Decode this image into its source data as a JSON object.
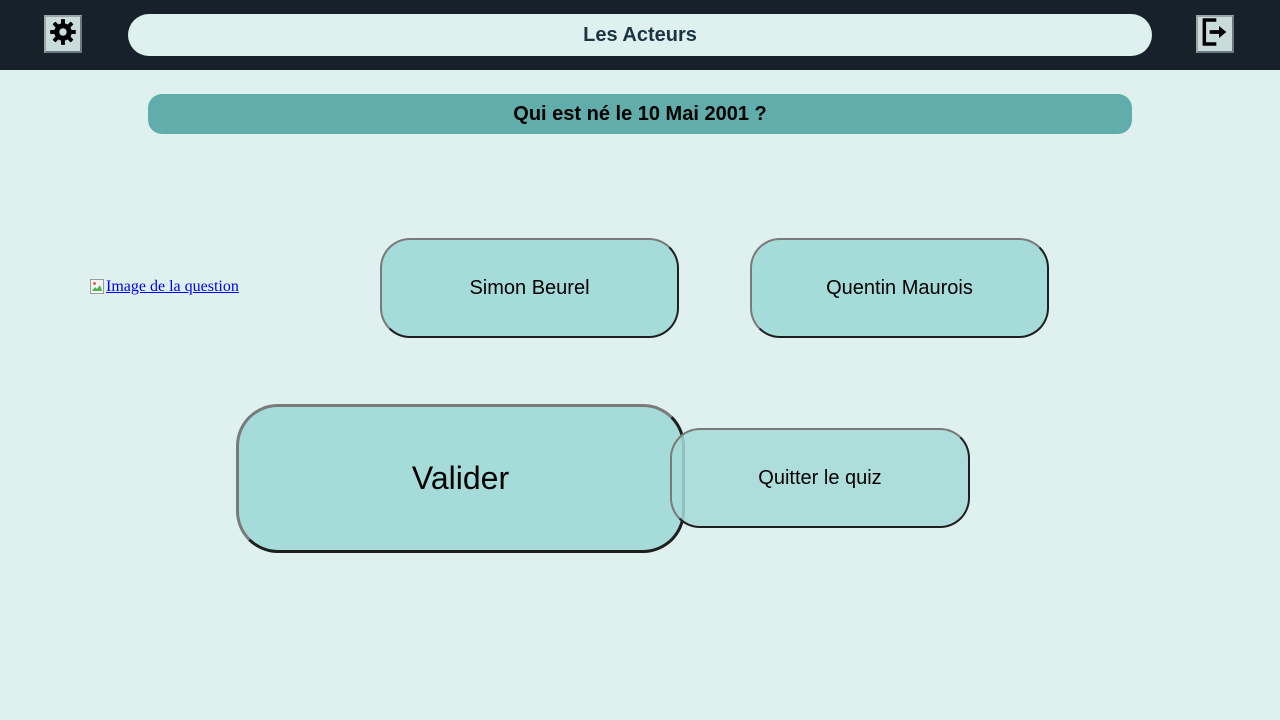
{
  "header": {
    "title": "Les Acteurs",
    "settings_icon": "gear-icon",
    "logout_icon": "logout-icon"
  },
  "question": {
    "text": "Qui est né le 10 Mai 2001 ?",
    "image_alt": "Image de la question"
  },
  "answers": [
    {
      "label": "Simon Beurel"
    },
    {
      "label": "Quentin Maurois"
    }
  ],
  "actions": {
    "validate_label": "Valider",
    "quit_label": "Quitter le quiz"
  },
  "colors": {
    "topbar": "#162129",
    "background": "#dff1ef",
    "question_bar": "#61adab",
    "button": "#a5dbd8",
    "title_text": "#1c3545"
  }
}
